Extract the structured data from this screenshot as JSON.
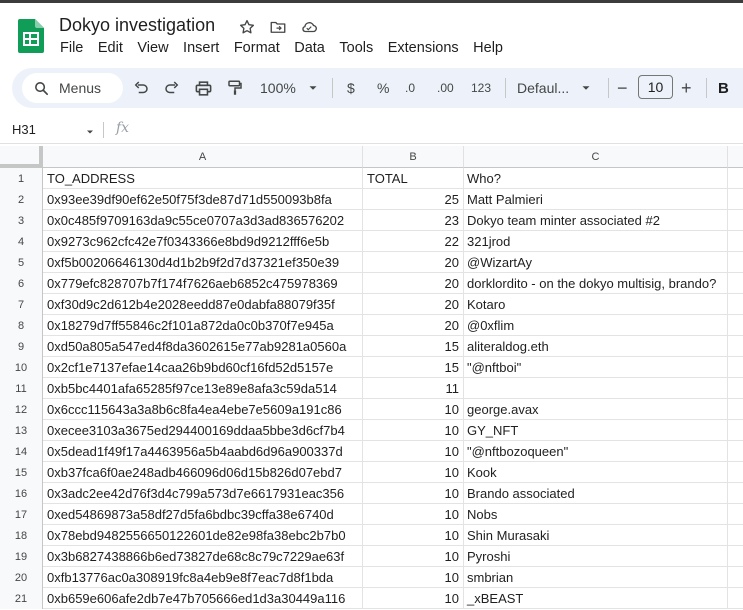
{
  "document": {
    "title": "Dokyo investigation"
  },
  "title_icons": [
    "star-icon",
    "move-to-folder-icon",
    "cloud-status-icon"
  ],
  "menu": [
    "File",
    "Edit",
    "View",
    "Insert",
    "Format",
    "Data",
    "Tools",
    "Extensions",
    "Help"
  ],
  "toolbar": {
    "menus_label": "Menus",
    "zoom": "100%",
    "currency": "$",
    "percent": "%",
    "decrease_decimal": ".0",
    "increase_decimal": ".00",
    "number_format": "123",
    "font": "Defaul...",
    "font_size": "10",
    "minus": "−",
    "plus": "+",
    "bold": "B"
  },
  "formula_bar": {
    "name_box": "H31",
    "fx": "fx"
  },
  "columns": [
    "A",
    "B",
    "C"
  ],
  "rows": [
    {
      "n": "1",
      "a": "TO_ADDRESS",
      "b": "TOTAL",
      "c": "Who?"
    },
    {
      "n": "2",
      "a": "0x93ee39df90ef62e50f75f3de87d71d550093b8fa",
      "b": "25",
      "c": "Matt Palmieri"
    },
    {
      "n": "3",
      "a": "0x0c485f9709163da9c55ce0707a3d3ad836576202",
      "b": "23",
      "c": "Dokyo team minter associated #2"
    },
    {
      "n": "4",
      "a": "0x9273c962cfc42e7f0343366e8bd9d9212fff6e5b",
      "b": "22",
      "c": "321jrod"
    },
    {
      "n": "5",
      "a": "0xf5b00206646130d4d1b2b9f2d7d37321ef350e39",
      "b": "20",
      "c": "@WizartAy"
    },
    {
      "n": "6",
      "a": "0x779efc828707b7f174f7626aeb6852c475978369",
      "b": "20",
      "c": "dorklordito - on the dokyo multisig, brando?"
    },
    {
      "n": "7",
      "a": "0xf30d9c2d612b4e2028eedd87e0dabfa88079f35f",
      "b": "20",
      "c": "Kotaro"
    },
    {
      "n": "8",
      "a": "0x18279d7ff55846c2f101a872da0c0b370f7e945a",
      "b": "20",
      "c": "@0xflim"
    },
    {
      "n": "9",
      "a": "0xd50a805a547ed4f8da3602615e77ab9281a0560a",
      "b": "15",
      "c": "aliteraldog.eth"
    },
    {
      "n": "10",
      "a": "0x2cf1e7137efae14caa26b9bd60cf16fd52d5157e",
      "b": "15",
      "c": "\"@nftboi\""
    },
    {
      "n": "11",
      "a": "0xb5bc4401afa65285f97ce13e89e8afa3c59da514",
      "b": "11",
      "c": ""
    },
    {
      "n": "12",
      "a": "0x6ccc115643a3a8b6c8fa4ea4ebe7e5609a191c86",
      "b": "10",
      "c": "george.avax"
    },
    {
      "n": "13",
      "a": "0xecee3103a3675ed294400169ddaa5bbe3d6cf7b4",
      "b": "10",
      "c": "GY_NFT"
    },
    {
      "n": "14",
      "a": "0x5dead1f49f17a4463956a5b4aabd6d96a900337d",
      "b": "10",
      "c": "\"@nftbozoqueen\""
    },
    {
      "n": "15",
      "a": "0xb37fca6f0ae248adb466096d06d15b826d07ebd7",
      "b": "10",
      "c": "Kook"
    },
    {
      "n": "16",
      "a": "0x3adc2ee42d76f3d4c799a573d7e6617931eac356",
      "b": "10",
      "c": "Brando associated"
    },
    {
      "n": "17",
      "a": "0xed54869873a58df27d5fa6bdbc39cffa38e6740d",
      "b": "10",
      "c": "Nobs"
    },
    {
      "n": "18",
      "a": "0x78ebd9482556650122601de82e98fa38ebc2b7b0",
      "b": "10",
      "c": "Shin Murasaki"
    },
    {
      "n": "19",
      "a": "0x3b6827438866b6ed73827de68c8c79c7229ae63f",
      "b": "10",
      "c": "Pyroshi"
    },
    {
      "n": "20",
      "a": "0xfb13776ac0a308919fc8a4eb9e8f7eac7d8f1bda",
      "b": "10",
      "c": "smbrian"
    },
    {
      "n": "21",
      "a": "0xb659e606afe2db7e47b705666ed1d3a30449a116",
      "b": "10",
      "c": "_xBEAST"
    }
  ],
  "colors": {
    "accent": "#0b57d0",
    "sheets_green": "#0f9d58",
    "toolbar_bg": "#edf2fa",
    "header_bg": "#f8f9fa"
  }
}
